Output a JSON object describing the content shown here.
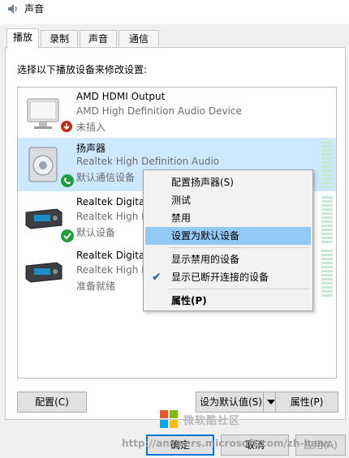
{
  "window": {
    "title": "声音"
  },
  "tabs": [
    {
      "label": "播放",
      "active": true
    },
    {
      "label": "录制",
      "active": false
    },
    {
      "label": "声音",
      "active": false
    },
    {
      "label": "通信",
      "active": false
    }
  ],
  "instruction": "选择以下播放设备来修改设置:",
  "devices": [
    {
      "name": "AMD HDMI Output",
      "description": "AMD High Definition Audio Device",
      "status": "未插入",
      "icon": "monitor-icon",
      "badge": "unplugged-badge-icon",
      "selected": false
    },
    {
      "name": "扬声器",
      "description": "Realtek High Definition Audio",
      "status": "默认通信设备",
      "icon": "speaker-icon",
      "badge": "phone-badge-icon",
      "selected": true
    },
    {
      "name": "Realtek Digital",
      "description": "Realtek High D",
      "status": "默认设备",
      "icon": "digital-receiver-icon",
      "badge": "default-check-badge-icon",
      "selected": false
    },
    {
      "name": "Realtek Digital",
      "description": "Realtek High D",
      "status": "准备就绪",
      "icon": "digital-receiver-icon",
      "badge": "",
      "selected": false
    }
  ],
  "context_menu": {
    "items": [
      {
        "label": "配置扬声器(S)"
      },
      {
        "label": "测试"
      },
      {
        "label": "禁用"
      },
      {
        "label": "设置为默认设备"
      },
      {
        "label": "显示禁用的设备"
      },
      {
        "label": "显示已断开连接的设备",
        "checked": true
      },
      {
        "label": "属性(P)"
      }
    ]
  },
  "buttons": {
    "configure": "配置(C)",
    "set_default": "设为默认值(S)",
    "properties": "属性(P)",
    "ok": "确定",
    "cancel": "取消",
    "apply": "应用(A)"
  },
  "watermark": {
    "text": "微软酷社区",
    "url": "http://answers.microsoft.com/zh-hans"
  },
  "colors": {
    "selection": "#cde8ff",
    "menu_hover": "#91c9f7",
    "accent": "#0078d7",
    "status_green": "#1e9e3e",
    "status_red": "#c42b1c"
  }
}
